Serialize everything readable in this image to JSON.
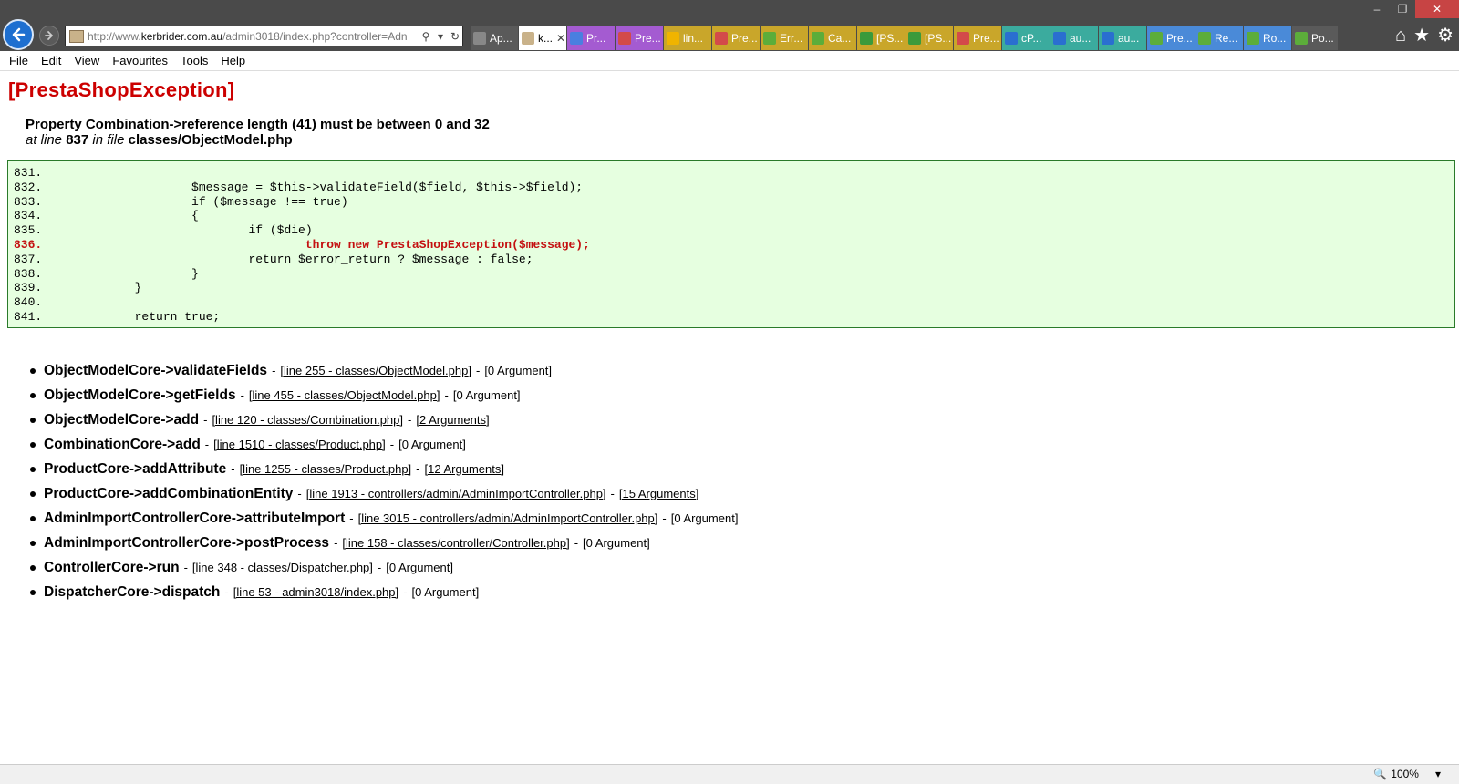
{
  "address_bar": {
    "url_prefix": "http://www.",
    "url_domain": "kerbrider.com.au",
    "url_rest": "/admin3018/index.php?controller=Adn"
  },
  "tabs": [
    {
      "label": "Ap...",
      "color": "#5a5a5a",
      "icon_color": "#888888",
      "active": false
    },
    {
      "label": "k...",
      "color": "#ffffff",
      "icon_color": "#c9b28a",
      "active": true
    },
    {
      "label": "Pr...",
      "color": "#a45bd1",
      "icon_color": "#4a7fe0",
      "active": false
    },
    {
      "label": "Pre...",
      "color": "#a45bd1",
      "icon_color": "#d34a4a",
      "active": false
    },
    {
      "label": "lin...",
      "color": "#c9a62a",
      "icon_color": "#f0b400",
      "active": false
    },
    {
      "label": "Pre...",
      "color": "#c9a62a",
      "icon_color": "#d34a4a",
      "active": false
    },
    {
      "label": "Err...",
      "color": "#c9a62a",
      "icon_color": "#5cad3a",
      "active": false
    },
    {
      "label": "Ca...",
      "color": "#c9a62a",
      "icon_color": "#5cad3a",
      "active": false
    },
    {
      "label": "[PS...",
      "color": "#c9a62a",
      "icon_color": "#3b9a3b",
      "active": false
    },
    {
      "label": "[PS...",
      "color": "#c9a62a",
      "icon_color": "#3b9a3b",
      "active": false
    },
    {
      "label": "Pre...",
      "color": "#c9a62a",
      "icon_color": "#d34a4a",
      "active": false
    },
    {
      "label": "cP...",
      "color": "#3bab9e",
      "icon_color": "#2a6fd0",
      "active": false
    },
    {
      "label": "au...",
      "color": "#3bab9e",
      "icon_color": "#2a6fd0",
      "active": false
    },
    {
      "label": "au...",
      "color": "#3bab9e",
      "icon_color": "#2a6fd0",
      "active": false
    },
    {
      "label": "Pre...",
      "color": "#4a8ad8",
      "icon_color": "#5cad3a",
      "active": false
    },
    {
      "label": "Re...",
      "color": "#4a8ad8",
      "icon_color": "#5cad3a",
      "active": false
    },
    {
      "label": "Ro...",
      "color": "#4a8ad8",
      "icon_color": "#5cad3a",
      "active": false
    },
    {
      "label": "Po...",
      "color": "#5a5a5a",
      "icon_color": "#5cad3a",
      "active": false
    }
  ],
  "menu": [
    "File",
    "Edit",
    "View",
    "Favourites",
    "Tools",
    "Help"
  ],
  "page": {
    "title": "[PrestaShopException]",
    "message": "Property Combination->reference length (41) must be between 0 and 32",
    "at_line_prefix": "at line",
    "line_number": "837",
    "in_file_prefix": "in file",
    "file": "classes/ObjectModel.php"
  },
  "code_lines": [
    {
      "text": "831.",
      "hl": false
    },
    {
      "text": "832.                     $message = $this->validateField($field, $this->$field);",
      "hl": false
    },
    {
      "text": "833.                     if ($message !== true)",
      "hl": false
    },
    {
      "text": "834.                     {",
      "hl": false
    },
    {
      "text": "835.                             if ($die)",
      "hl": false
    },
    {
      "text": "836.                                     throw new PrestaShopException($message);",
      "hl": true
    },
    {
      "text": "837.                             return $error_return ? $message : false;",
      "hl": false
    },
    {
      "text": "838.                     }",
      "hl": false
    },
    {
      "text": "839.             }",
      "hl": false
    },
    {
      "text": "840.",
      "hl": false
    },
    {
      "text": "841.             return true;",
      "hl": false
    }
  ],
  "trace": [
    {
      "fn": "ObjectModelCore->validateFields",
      "loc": "[line 255 - classes/ObjectModel.php]",
      "args": "[0 Argument]",
      "args_link": false
    },
    {
      "fn": "ObjectModelCore->getFields",
      "loc": "[line 455 - classes/ObjectModel.php]",
      "args": "[0 Argument]",
      "args_link": false
    },
    {
      "fn": "ObjectModelCore->add",
      "loc": "[line 120 - classes/Combination.php]",
      "args": "[2 Arguments]",
      "args_link": true
    },
    {
      "fn": "CombinationCore->add",
      "loc": "[line 1510 - classes/Product.php]",
      "args": "[0 Argument]",
      "args_link": false
    },
    {
      "fn": "ProductCore->addAttribute",
      "loc": "[line 1255 - classes/Product.php]",
      "args": "[12 Arguments]",
      "args_link": true
    },
    {
      "fn": "ProductCore->addCombinationEntity",
      "loc": "[line 1913 - controllers/admin/AdminImportController.php]",
      "args": "[15 Arguments]",
      "args_link": true
    },
    {
      "fn": "AdminImportControllerCore->attributeImport",
      "loc": "[line 3015 - controllers/admin/AdminImportController.php]",
      "args": "[0 Argument]",
      "args_link": false
    },
    {
      "fn": "AdminImportControllerCore->postProcess",
      "loc": "[line 158 - classes/controller/Controller.php]",
      "args": "[0 Argument]",
      "args_link": false
    },
    {
      "fn": "ControllerCore->run",
      "loc": "[line 348 - classes/Dispatcher.php]",
      "args": "[0 Argument]",
      "args_link": false
    },
    {
      "fn": "DispatcherCore->dispatch",
      "loc": "[line 53 - admin3018/index.php]",
      "args": "[0 Argument]",
      "args_link": false
    }
  ],
  "separator": "-",
  "status": {
    "zoom": "100%"
  },
  "colors": {
    "exception_red": "#cc0000",
    "code_bg": "#e6ffe0",
    "highlight_line": "#c41010",
    "back_button": "#1e6fd0"
  }
}
